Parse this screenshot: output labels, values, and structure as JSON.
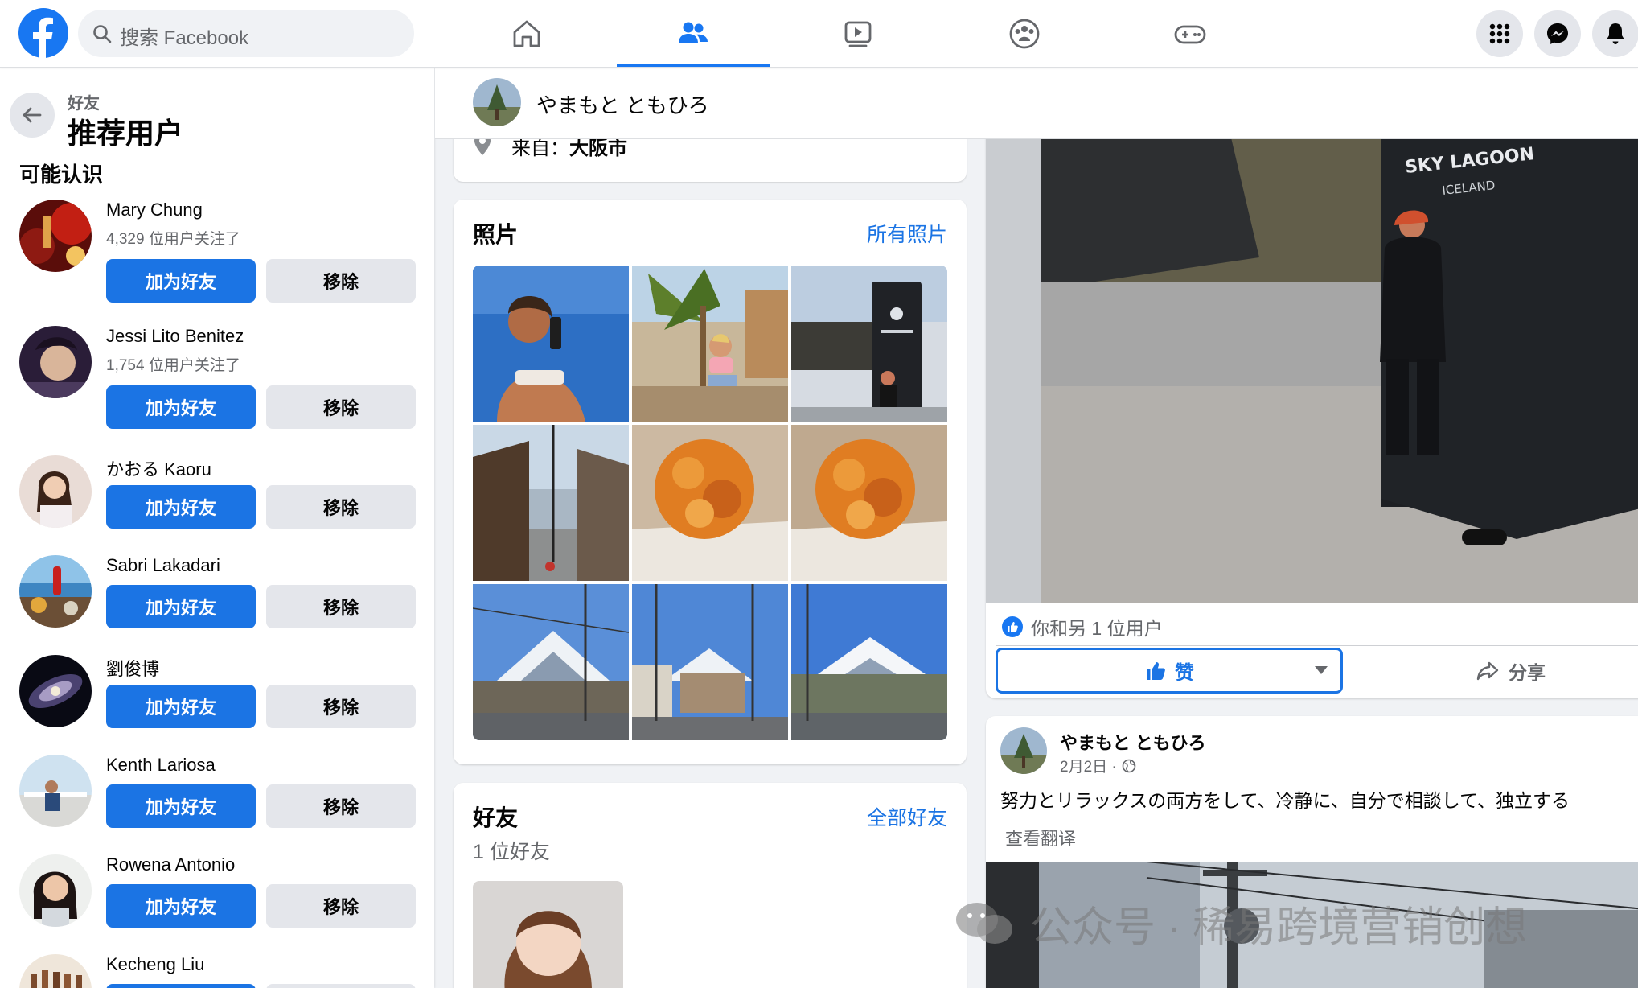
{
  "topbar": {
    "search_placeholder": "搜索 Facebook",
    "nav": [
      "home-icon",
      "friends-icon",
      "watch-icon",
      "groups-icon",
      "gaming-icon"
    ],
    "active_nav": "friends-icon",
    "accent": "#1877f2"
  },
  "sidebar": {
    "breadcrumb": "好友",
    "title": "推荐用户",
    "section": "可能认识",
    "add_label": "加为好友",
    "remove_label": "移除",
    "suggestions": [
      {
        "name": "Mary Chung",
        "meta": "4,329 位用户关注了"
      },
      {
        "name": "Jessi Lito Benitez",
        "meta": "1,754 位用户关注了"
      },
      {
        "name": "かおる Kaoru",
        "meta": ""
      },
      {
        "name": "Sabri Lakadari",
        "meta": ""
      },
      {
        "name": "劉俊博",
        "meta": ""
      },
      {
        "name": "Kenth Lariosa",
        "meta": ""
      },
      {
        "name": "Rowena Antonio",
        "meta": ""
      },
      {
        "name": "Kecheng Liu",
        "meta": ""
      }
    ]
  },
  "profile": {
    "name": "やまもと ともひろ",
    "from_label": "来自：",
    "from_city": "大阪市"
  },
  "photos": {
    "title": "照片",
    "link": "所有照片"
  },
  "friends": {
    "title": "好友",
    "link": "全部好友",
    "count": "1 位好友"
  },
  "post1": {
    "sign_text": "SKY LAGOON",
    "sign_sub": "ICELAND",
    "reactions": "你和另 1 位用户",
    "like_label": "赞",
    "share_label": "分享"
  },
  "post2": {
    "author": "やまもと ともひろ",
    "date": "2月2日 ·",
    "text": "努力とリラックスの両方をして、冷静に、自分で相談して、独立する",
    "translate": "查看翻译"
  },
  "watermark": "公众号 · 稀易跨境营销创想"
}
